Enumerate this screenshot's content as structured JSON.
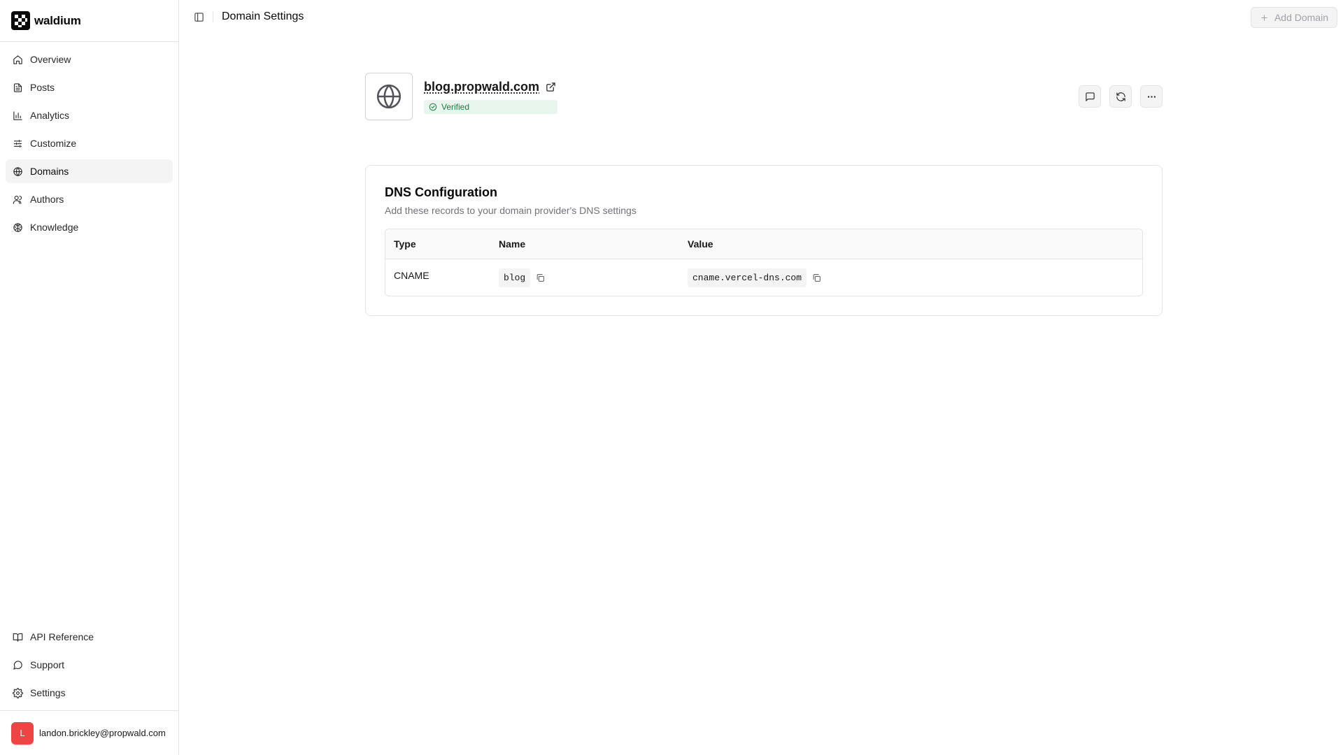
{
  "brand": {
    "name": "waldium"
  },
  "sidebar": {
    "items": [
      {
        "label": "Overview",
        "icon": "home-icon"
      },
      {
        "label": "Posts",
        "icon": "file-text-icon"
      },
      {
        "label": "Analytics",
        "icon": "bar-chart-icon"
      },
      {
        "label": "Customize",
        "icon": "sliders-icon"
      },
      {
        "label": "Domains",
        "icon": "globe-icon",
        "active": true
      },
      {
        "label": "Authors",
        "icon": "users-icon"
      },
      {
        "label": "Knowledge",
        "icon": "brain-icon"
      }
    ],
    "bottom_items": [
      {
        "label": "API Reference",
        "icon": "book-open-icon"
      },
      {
        "label": "Support",
        "icon": "message-circle-icon"
      },
      {
        "label": "Settings",
        "icon": "gear-icon"
      }
    ],
    "user": {
      "initial": "L",
      "email": "landon.brickley@propwald.com",
      "avatar_color": "#ef4444"
    }
  },
  "header": {
    "title": "Domain Settings",
    "add_domain_label": "Add Domain"
  },
  "domain": {
    "name": "blog.propwald.com",
    "status": "Verified",
    "status_color": "#15803d"
  },
  "dns": {
    "title": "DNS Configuration",
    "subtitle": "Add these records to your domain provider's DNS settings",
    "columns": {
      "type": "Type",
      "name": "Name",
      "value": "Value"
    },
    "records": [
      {
        "type": "CNAME",
        "name": "blog",
        "value": "cname.vercel-dns.com"
      }
    ]
  }
}
